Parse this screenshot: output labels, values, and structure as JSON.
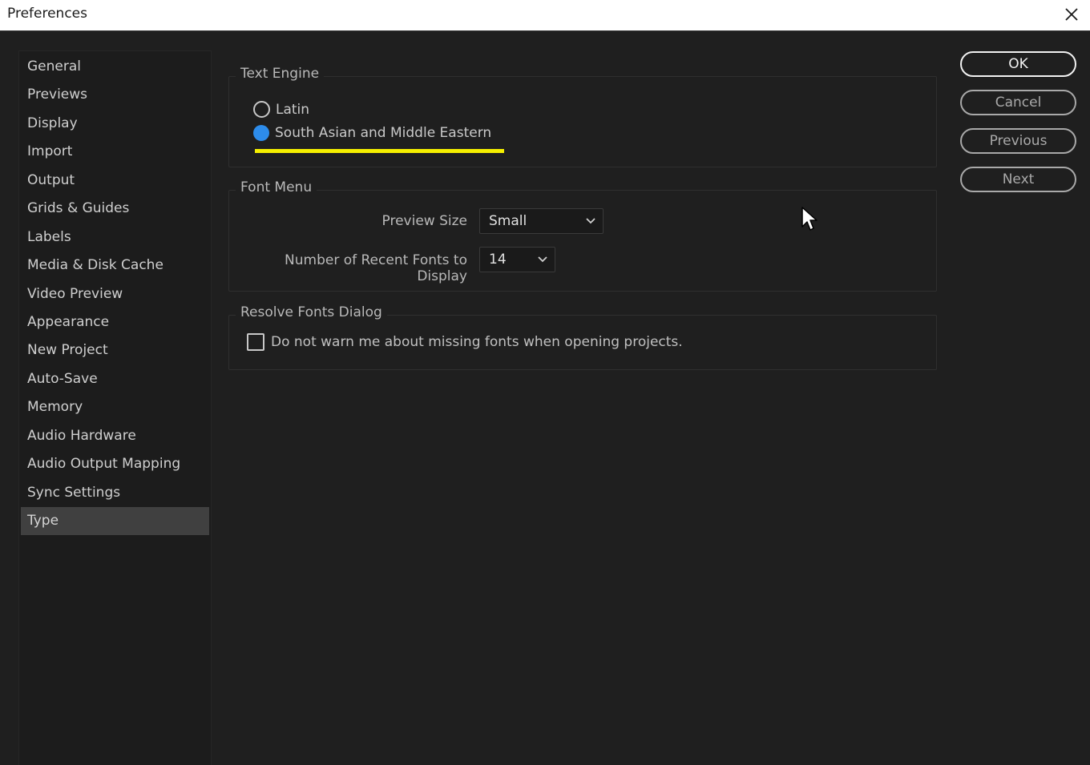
{
  "window": {
    "title": "Preferences"
  },
  "sidebar": {
    "items": [
      {
        "label": "General"
      },
      {
        "label": "Previews"
      },
      {
        "label": "Display"
      },
      {
        "label": "Import"
      },
      {
        "label": "Output"
      },
      {
        "label": "Grids & Guides"
      },
      {
        "label": "Labels"
      },
      {
        "label": "Media & Disk Cache"
      },
      {
        "label": "Video Preview"
      },
      {
        "label": "Appearance"
      },
      {
        "label": "New Project"
      },
      {
        "label": "Auto-Save"
      },
      {
        "label": "Memory"
      },
      {
        "label": "Audio Hardware"
      },
      {
        "label": "Audio Output Mapping"
      },
      {
        "label": "Sync Settings"
      },
      {
        "label": "Type"
      }
    ],
    "selected": "Type"
  },
  "text_engine": {
    "legend": "Text Engine",
    "options": [
      {
        "label": "Latin",
        "checked": false
      },
      {
        "label": "South Asian and Middle Eastern",
        "checked": true
      }
    ],
    "highlight_color": "#f5ef00"
  },
  "font_menu": {
    "legend": "Font Menu",
    "preview_size_label": "Preview Size",
    "preview_size_value": "Small",
    "recent_fonts_label": "Number of Recent Fonts to Display",
    "recent_fonts_value": "14"
  },
  "resolve_fonts": {
    "legend": "Resolve Fonts Dialog",
    "checkbox_label": "Do not warn me about missing fonts when opening projects.",
    "checked": false
  },
  "buttons": {
    "ok": "OK",
    "cancel": "Cancel",
    "previous": "Previous",
    "next": "Next"
  },
  "colors": {
    "background": "#1f1f1f",
    "accent": "#2d8ceb"
  },
  "icons": [
    "close-icon",
    "chevron-down-icon",
    "mouse-pointer-icon"
  ]
}
